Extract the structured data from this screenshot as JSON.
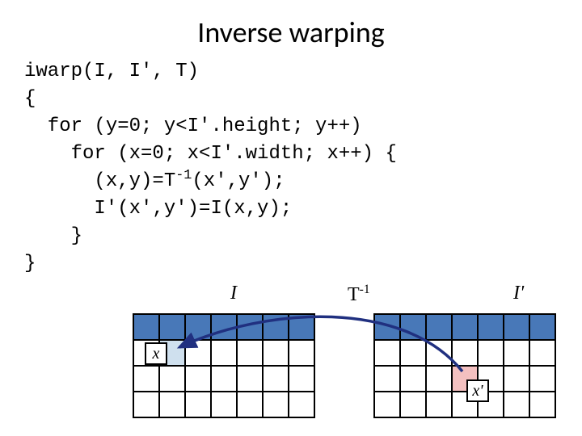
{
  "title": "Inverse warping",
  "code": {
    "l1": "iwarp(I, I', T)",
    "l2": "{",
    "l3": "  for (y=0; y<I'.height; y++)",
    "l4": "    for (x=0; x<I'.width; x++) {",
    "l5a": "      (x,y)=T",
    "l5b": "-1",
    "l5c": "(x',y');",
    "l6": "      I'(x',y')=I(x,y);",
    "l7": "    }",
    "l8": "}"
  },
  "labels": {
    "I": "I",
    "T": "T",
    "neg1": "-1",
    "Iprime": "I'",
    "x": "x",
    "xprime": "x'"
  },
  "chart_data": {
    "type": "table",
    "description": "Two image grids illustrating inverse warping. Left grid I (7 cols × 4 rows) with point x at approx col 1, row 1 (light blue). Right grid I' (7 cols × 4 rows) with point x' at approx col 3, row 2 (pink). An arrow labeled T^{-1} curves from x' back to x.",
    "left_grid": {
      "rows": 4,
      "cols": 7,
      "blue_row": 0,
      "point": {
        "row": 1,
        "col": 1,
        "color": "lightblue"
      },
      "label": "I",
      "point_label": "x"
    },
    "right_grid": {
      "rows": 4,
      "cols": 7,
      "blue_row": 0,
      "point": {
        "row": 2,
        "col": 3,
        "color": "pink"
      },
      "label": "I'",
      "point_label": "x'"
    },
    "arrow": {
      "from": "x'",
      "to": "x",
      "label": "T^{-1}",
      "color": "#203080"
    }
  }
}
